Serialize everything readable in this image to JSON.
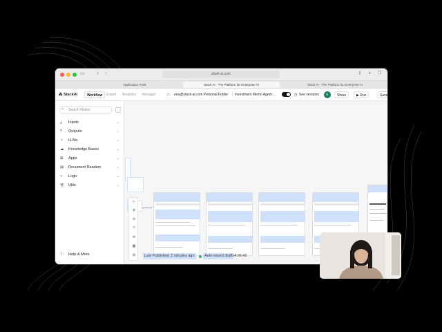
{
  "browser": {
    "url": "stack-ai.com",
    "tabs": [
      "Application Node",
      "Stack AI - The Platform for Enterprise AI",
      "Stack AI - The Platform for Enterprise AI"
    ]
  },
  "app": {
    "logo": "StackAI",
    "nav_tabs": [
      "Workflow",
      "Export",
      "Analytics",
      "Manager"
    ],
    "folder": "ena@stack-ai.com Personal Folder",
    "project": "Investment Memo Agent ...",
    "see_versions": "See versions",
    "avatar": "E",
    "share": "Share",
    "run": "Run",
    "save": "Save"
  },
  "sidebar": {
    "search_placeholder": "Search Nodes",
    "items": [
      {
        "label": "Inputs",
        "icon": "download-icon"
      },
      {
        "label": "Outputs",
        "icon": "upload-icon"
      },
      {
        "label": "LLMs",
        "icon": "sparkle-icon"
      },
      {
        "label": "Knowledge Bases",
        "icon": "cloud-icon"
      },
      {
        "label": "Apps",
        "icon": "grid-icon"
      },
      {
        "label": "Document Readers",
        "icon": "document-icon"
      },
      {
        "label": "Logic",
        "icon": "branch-icon"
      },
      {
        "label": "Utils",
        "icon": "wrench-icon"
      }
    ],
    "help": "Help & More"
  },
  "status": {
    "last_published": "Last Published",
    "ago": "3 minutes ago",
    "autosaved": "Auto-saved draft",
    "time": "14:05:42"
  },
  "colors": {
    "accent": "#2f6fe4",
    "highlight": "#cfe0fb",
    "toggle": "#111111"
  }
}
